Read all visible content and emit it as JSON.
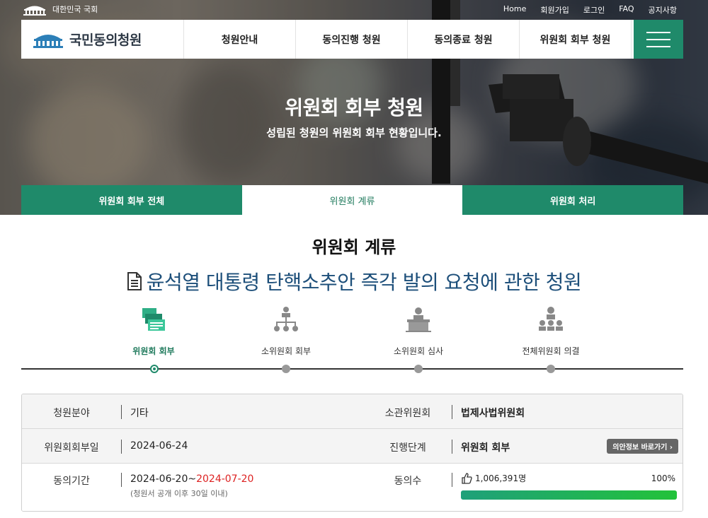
{
  "topbar": {
    "gov_name": "대한민국 국회",
    "links": [
      "Home",
      "회원가입",
      "로그인",
      "FAQ",
      "공지사항"
    ]
  },
  "navbar": {
    "brand": "국민동의청원",
    "items": [
      "청원안내",
      "동의진행 청원",
      "동의종료 청원",
      "위원회 회부 청원"
    ],
    "menu_icon": "hamburger-icon"
  },
  "hero": {
    "title": "위원회 회부 청원",
    "subtitle": "성립된 청원의 위원회 회부 현황입니다."
  },
  "tabs": [
    {
      "label": "위원회 회부 전체",
      "active": false
    },
    {
      "label": "위원회 계류",
      "active": true
    },
    {
      "label": "위원회 처리",
      "active": false
    }
  ],
  "section_title": "위원회 계류",
  "petition_title": "윤석열 대통령 탄핵소추안 즉각 발의 요청에 관한 청원",
  "steps": [
    {
      "label": "위원회 회부",
      "icon": "documents-stack-icon",
      "done": true
    },
    {
      "label": "소위원회 회부",
      "icon": "org-chart-icon",
      "done": false
    },
    {
      "label": "소위원회 심사",
      "icon": "podium-speaker-icon",
      "done": false
    },
    {
      "label": "전체위원회 의결",
      "icon": "assembly-people-icon",
      "done": false
    }
  ],
  "info": {
    "field_label": "청원분야",
    "field_value": "기타",
    "committee_label": "소관위원회",
    "committee_value": "법제사법위원회",
    "referral_date_label": "위원회회부일",
    "referral_date_value": "2024-06-24",
    "stage_label": "진행단계",
    "stage_value": "위원회 회부",
    "bill_link": "의안정보 바로가기",
    "period_label": "동의기간",
    "period_start": "2024-06-20~",
    "period_end": "2024-07-20",
    "period_note": "(청원서 공개 이후 30일 이내)",
    "agree_label": "동의수",
    "agree_count": "1,006,391명",
    "agree_percent_label": "100%",
    "agree_progress": 1.0
  },
  "colors": {
    "primary_green": "#1f8a6a",
    "title_blue": "#1d4f7a",
    "deadline_red": "#dd2222"
  }
}
